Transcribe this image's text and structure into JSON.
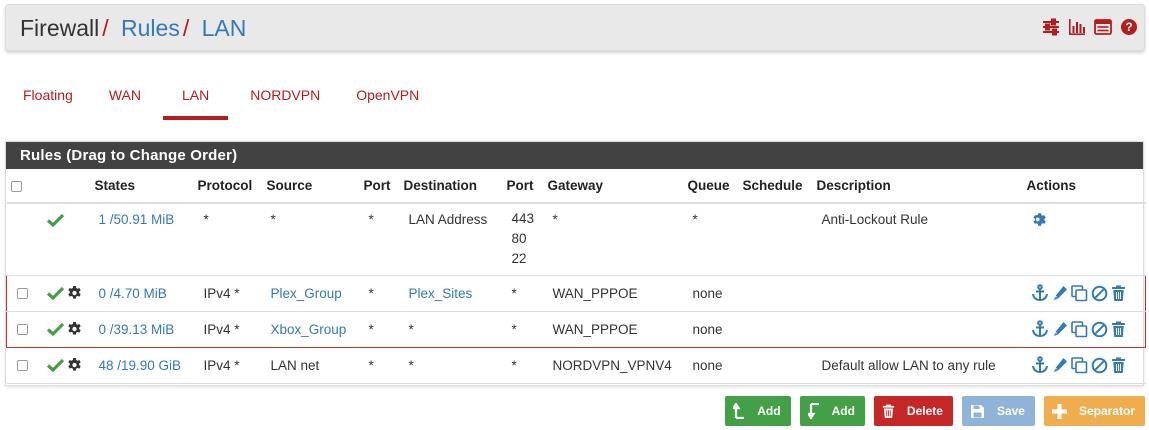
{
  "breadcrumb": {
    "root": "Firewall",
    "separator": "/",
    "rules": "Rules",
    "current": "LAN"
  },
  "header_icons": [
    "sliders-icon",
    "bar-chart-icon",
    "table-list-icon",
    "help-circle-icon"
  ],
  "tabs": [
    {
      "label": "Floating",
      "active": false
    },
    {
      "label": "WAN",
      "active": false
    },
    {
      "label": "LAN",
      "active": true
    },
    {
      "label": "NORDVPN",
      "active": false
    },
    {
      "label": "OpenVPN",
      "active": false
    }
  ],
  "panel": {
    "title": "Rules (Drag to Change Order)"
  },
  "columns": [
    "",
    "",
    "States",
    "Protocol",
    "Source",
    "Port",
    "Destination",
    "Port",
    "Gateway",
    "Queue",
    "Schedule",
    "Description",
    "Actions"
  ],
  "rows": [
    {
      "id": "anti",
      "states": "1 /50.91 MiB",
      "protocol": "*",
      "source": "*",
      "port": "*",
      "destination": "LAN Address",
      "dest_port_lines": [
        "443",
        "80",
        "22"
      ],
      "gateway": "*",
      "queue": "*",
      "schedule": "",
      "description": "Anti-Lockout Rule"
    },
    {
      "id": "plex",
      "states": "0 /4.70 MiB",
      "protocol": "IPv4 *",
      "source": "Plex_Group",
      "port": "*",
      "destination": "Plex_Sites",
      "dest_port": "*",
      "gateway": "WAN_PPPOE",
      "queue": "none",
      "schedule": "",
      "description": ""
    },
    {
      "id": "xbox",
      "states": "0 /39.13 MiB",
      "protocol": "IPv4 *",
      "source": "Xbox_Group",
      "port": "*",
      "destination": "*",
      "dest_port": "*",
      "gateway": "WAN_PPPOE",
      "queue": "none",
      "schedule": "",
      "description": ""
    },
    {
      "id": "lan",
      "states": "48 /19.90 GiB",
      "protocol": "IPv4 *",
      "source": "LAN net",
      "port": "*",
      "destination": "*",
      "dest_port": "*",
      "gateway": "NORDVPN_VPNV4",
      "queue": "none",
      "schedule": "",
      "description": "Default allow LAN to any rule"
    }
  ],
  "buttons": {
    "add_top": "Add",
    "add_bottom": "Add",
    "delete": "Delete",
    "save": "Save",
    "separator": "Separator"
  },
  "colors": {
    "accent_red": "#b71c1c",
    "link_blue": "#337ab7",
    "pass_green": "#43a047",
    "panel_header": "#424242"
  }
}
